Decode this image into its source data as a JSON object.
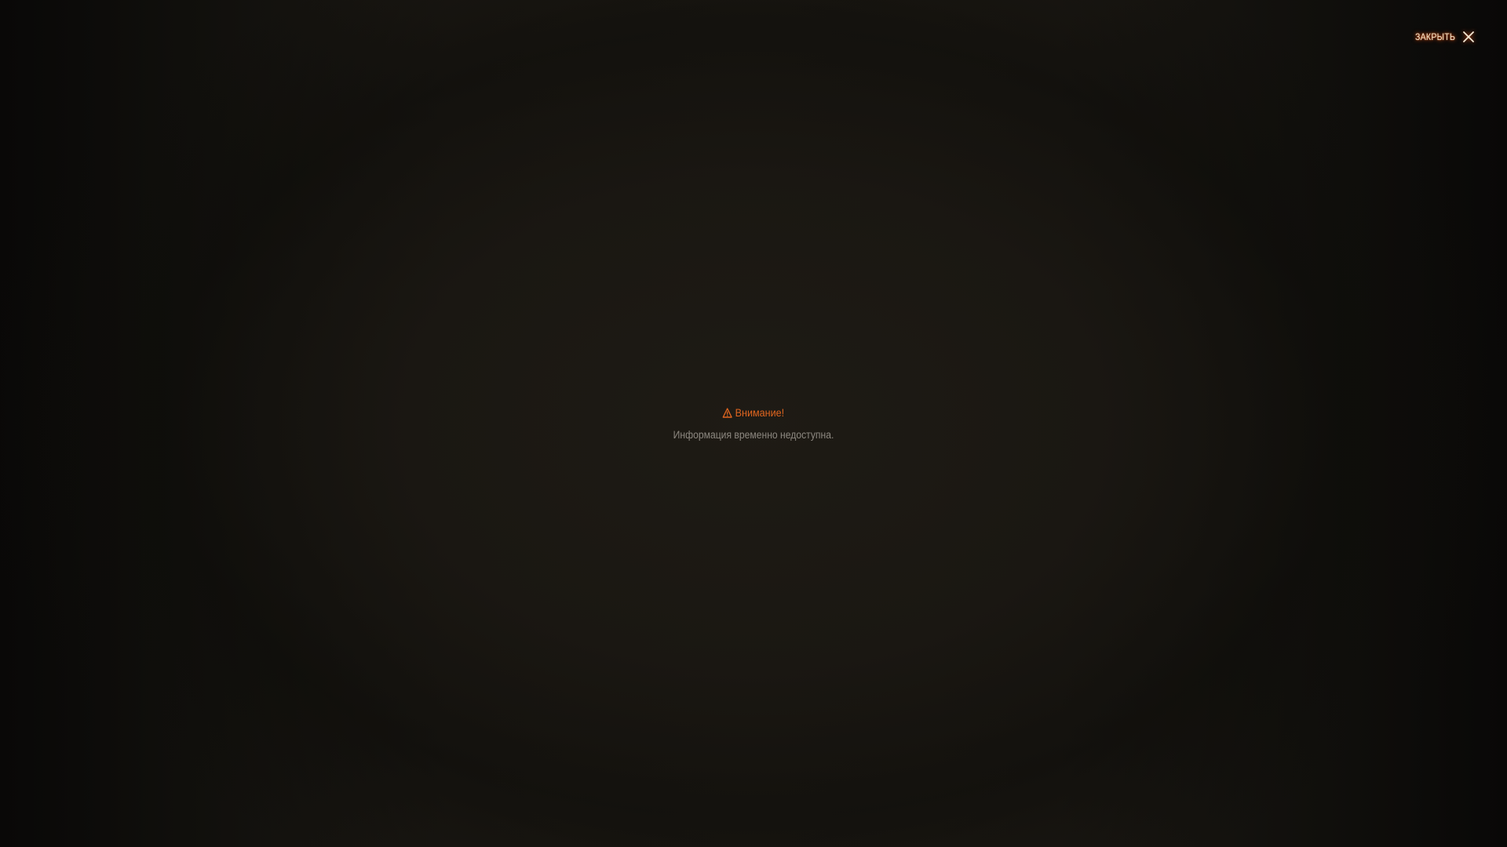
{
  "header": {
    "close_label": "ЗАКРЫТЬ",
    "close_icon": "close-icon"
  },
  "notice": {
    "icon": "warning-icon",
    "title": "Внимание!",
    "message": "Информация временно недоступна."
  },
  "colors": {
    "accent": "#e0651f",
    "close_glow": "#ff5a14",
    "message_text": "#8d8880",
    "background": "#1c1913"
  }
}
